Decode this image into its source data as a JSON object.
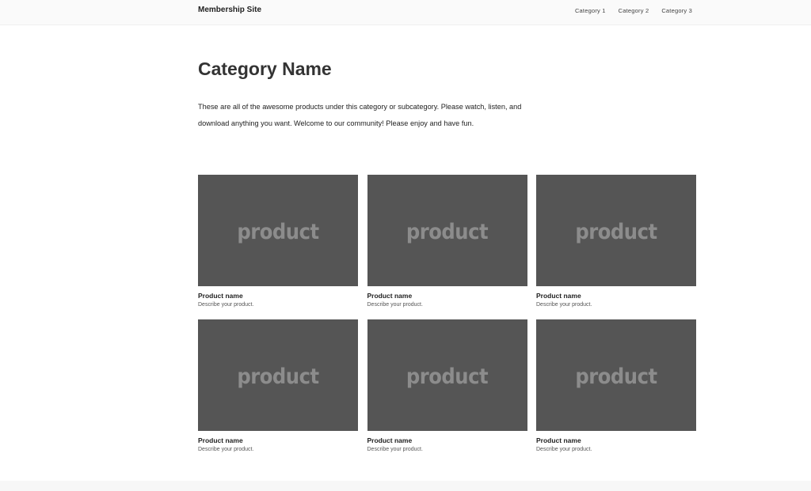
{
  "header": {
    "brand": "Membership Site",
    "nav": [
      "Category 1",
      "Category 2",
      "Category 3"
    ]
  },
  "main": {
    "title": "Category Name",
    "description": "These are all of the awesome products under this category or subcategory. Please watch, listen, and download anything you want. Welcome to our community! Please enjoy and have fun."
  },
  "products": [
    {
      "thumb_text": "product",
      "name": "Product name",
      "description": "Describe your product."
    },
    {
      "thumb_text": "product",
      "name": "Product name",
      "description": "Describe your product."
    },
    {
      "thumb_text": "product",
      "name": "Product name",
      "description": "Describe your product."
    },
    {
      "thumb_text": "product",
      "name": "Product name",
      "description": "Describe your product."
    },
    {
      "thumb_text": "product",
      "name": "Product name",
      "description": "Describe your product."
    },
    {
      "thumb_text": "product",
      "name": "Product name",
      "description": "Describe your product."
    }
  ],
  "colors": {
    "thumbnail_bg": "#555555",
    "thumbnail_text": "#8c8c8c"
  }
}
